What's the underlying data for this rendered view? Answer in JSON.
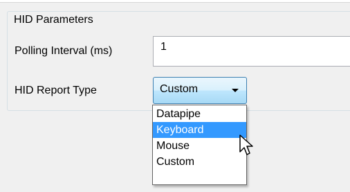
{
  "hid_parameters": {
    "title": "HID Parameters",
    "polling_interval_label": "Polling Interval (ms)",
    "polling_interval_value": "1",
    "report_type_label": "HID Report Type",
    "report_type_selected": "Custom",
    "dropdown_options": [
      {
        "label": "Datapipe",
        "highlighted": false
      },
      {
        "label": "Keyboard",
        "highlighted": true
      },
      {
        "label": "Mouse",
        "highlighted": false
      },
      {
        "label": "Custom",
        "highlighted": false
      }
    ]
  },
  "colors": {
    "highlight": "#3399ff",
    "combo_border": "#3c7fb1",
    "panel_border": "#d5dfe5"
  }
}
